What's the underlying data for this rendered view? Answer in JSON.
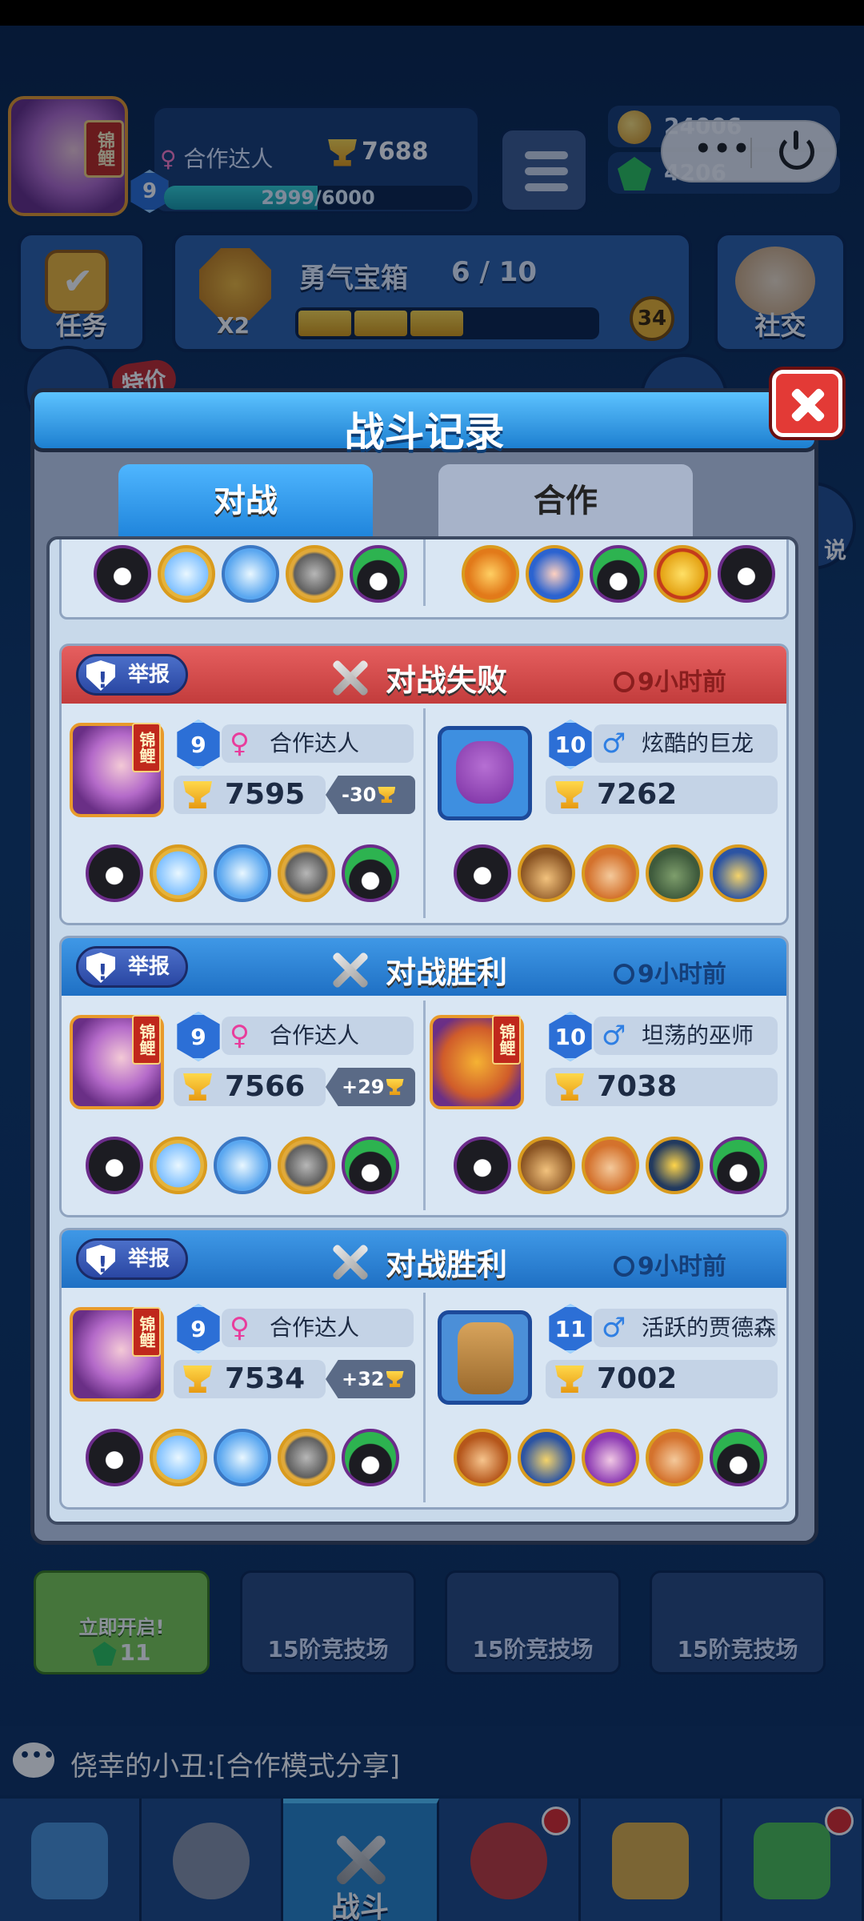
{
  "hub": {
    "player_name": "合作达人",
    "player_level": "9",
    "trophies": "7688",
    "xp_text": "2999/6000",
    "xp_progress": 0.4998,
    "koi_tag": "锦鲤",
    "gold": "24006",
    "gems": "4206",
    "tasks_label": "任务",
    "courage_chest_label": "勇气宝箱",
    "courage_chest_count": "6 / 10",
    "courage_chest_progress": 0.6,
    "chest_multiplier": "X2",
    "chest_badge": "34",
    "social_label": "社交",
    "special_offer": "特价",
    "side_label": "说",
    "chest_slots": [
      {
        "top": "立即开启!",
        "cost": "11"
      },
      {
        "label": "15阶竞技场"
      },
      {
        "label": "15阶竞技场"
      },
      {
        "label": "15阶竞技场"
      }
    ],
    "chat_text": "侥幸的小丑:[合作模式分享]",
    "nav": {
      "battle_label": "战斗"
    }
  },
  "modal": {
    "title": "战斗记录",
    "tabs": [
      "对战",
      "合作"
    ],
    "report_label": "举报"
  },
  "records": [
    {
      "result": "对战失败",
      "outcome": "loss",
      "time": "9小时前",
      "me": {
        "level": "9",
        "name": "合作达人",
        "trophies": "7595",
        "delta": "-30",
        "team": [
          "dark",
          "ice",
          "crystal",
          "knight",
          "green"
        ]
      },
      "opponent": {
        "level": "10",
        "name": "炫酷的巨龙",
        "trophies": "7262",
        "team": [
          "dark",
          "cowboy",
          "dwarf",
          "ogre",
          "robot"
        ]
      }
    },
    {
      "result": "对战胜利",
      "outcome": "win",
      "time": "9小时前",
      "me": {
        "level": "9",
        "name": "合作达人",
        "trophies": "7566",
        "delta": "+29",
        "team": [
          "dark",
          "ice",
          "crystal",
          "knight",
          "green"
        ]
      },
      "opponent": {
        "level": "10",
        "name": "坦荡的巫师",
        "trophies": "7038",
        "team": [
          "dark",
          "cowboy",
          "dwarf",
          "mask",
          "green"
        ]
      }
    },
    {
      "result": "对战胜利",
      "outcome": "win",
      "time": "9小时前",
      "me": {
        "level": "9",
        "name": "合作达人",
        "trophies": "7534",
        "delta": "+32",
        "team": [
          "dark",
          "ice",
          "crystal",
          "knight",
          "green"
        ]
      },
      "opponent": {
        "level": "11",
        "name": "活跃的贾德森",
        "trophies": "7002",
        "team": [
          "monkey",
          "robot",
          "purple",
          "dwarf",
          "green"
        ]
      }
    }
  ],
  "partial_record": {
    "my_team": [
      "dark",
      "ice",
      "crystal",
      "knight",
      "green"
    ],
    "opponent_team": [
      "fire",
      "bluegirl",
      "green",
      "yellow",
      "dark"
    ]
  }
}
